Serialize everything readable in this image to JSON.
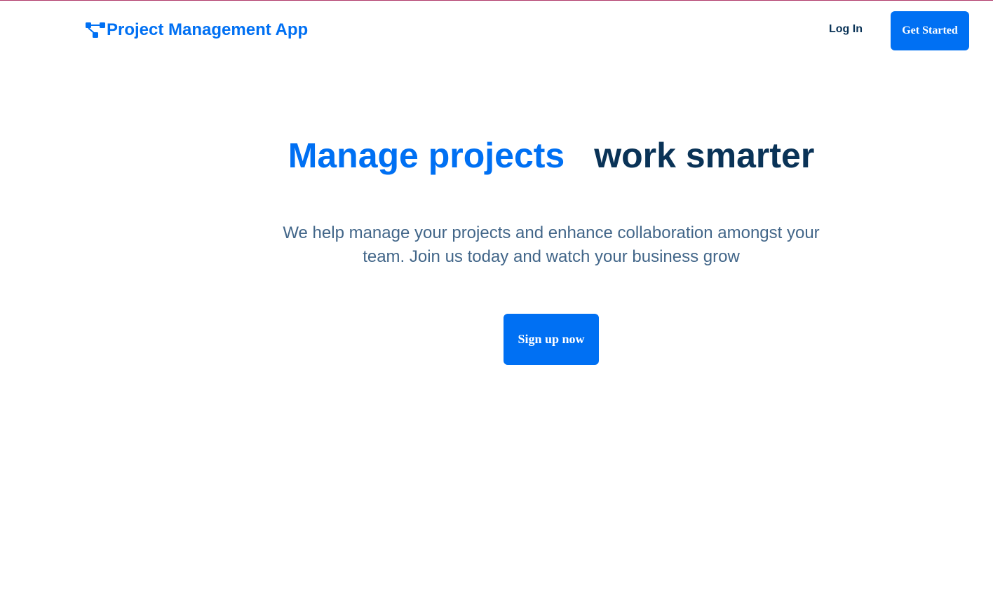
{
  "header": {
    "brand_name": "Project Management App",
    "brand_icon": "workflow-icon",
    "login_label": "Log In",
    "get_started_label": "Get Started"
  },
  "hero": {
    "title_accent": "Manage projects",
    "title_rest": "work smarter",
    "subtitle": "We help manage your projects and enhance collaboration amongst your team. Join us today and watch your business grow",
    "cta_label": "Sign up now"
  },
  "colors": {
    "accent": "#0070f3",
    "heading_dark": "#0a3357",
    "body_text": "#426689",
    "top_border": "#b03a6a"
  }
}
